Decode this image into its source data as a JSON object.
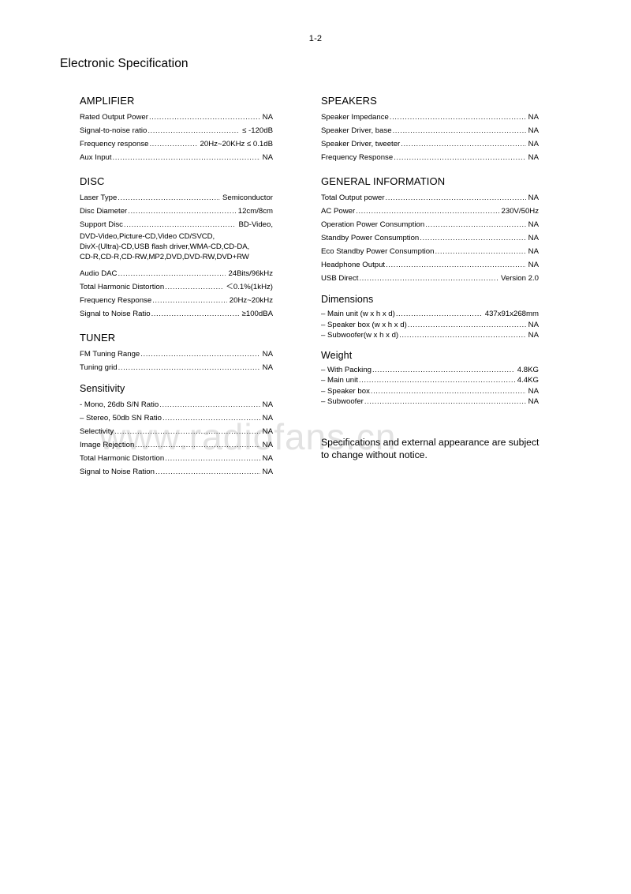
{
  "header": {
    "page_number": "1-2",
    "title": "Electronic Specification"
  },
  "watermark": "www.radiofans.cn",
  "left_column": {
    "amplifier": {
      "heading": "AMPLIFIER",
      "rows": [
        {
          "label": "Rated Output Power",
          "value": "NA"
        },
        {
          "label": "Signal-to-noise ratio",
          "value": "≤ -120dB"
        },
        {
          "label": "Frequency response",
          "value": "20Hz~20KHz  ≤ 0.1dB"
        },
        {
          "label": "Aux Input",
          "value": "NA"
        }
      ]
    },
    "disc": {
      "heading": "DISC",
      "rows": [
        {
          "label": "Laser Type",
          "value": "Semiconductor"
        },
        {
          "label": "Disc Diameter",
          "value": "12cm/8cm"
        },
        {
          "label": "Support Disc",
          "value": "BD-Video,"
        }
      ],
      "support_disc_continuation": [
        "DVD-Video,Picture-CD,Video CD/SVCD,",
        "DivX-(Ultra)-CD,USB flash driver,WMA-CD,CD-DA,",
        "CD-R,CD-R,CD-RW,MP2,DVD,DVD-RW,DVD+RW"
      ],
      "rows2": [
        {
          "label": "Audio DAC",
          "value": "24Bits/96kHz"
        },
        {
          "label": "Total Harmonic Distortion",
          "value": "＜0.1%(1kHz)"
        },
        {
          "label": "Frequency Response",
          "value": "20Hz~20kHz"
        },
        {
          "label": "Signal to Noise Ratio",
          "value": "≥100dBA"
        }
      ]
    },
    "tuner": {
      "heading": "TUNER",
      "rows": [
        {
          "label": "FM Tuning Range",
          "value": "NA"
        },
        {
          "label": "Tuning grid",
          "value": "NA"
        }
      ]
    },
    "sensitivity": {
      "heading": "Sensitivity",
      "rows": [
        {
          "label": "- Mono, 26db S/N Ratio",
          "value": "NA"
        },
        {
          "label": "– Stereo, 50db SN Ratio",
          "value": "NA"
        },
        {
          "label": "Selectivity",
          "value": "NA"
        },
        {
          "label": "Image Rejection",
          "value": "NA"
        },
        {
          "label": "Total Harmonic Distortion",
          "value": "NA"
        },
        {
          "label": "Signal to Noise Ration",
          "value": "NA"
        }
      ]
    }
  },
  "right_column": {
    "speakers": {
      "heading": "SPEAKERS",
      "rows": [
        {
          "label": "Speaker Impedance",
          "value": "NA"
        },
        {
          "label": "Speaker Driver, base",
          "value": "NA"
        },
        {
          "label": "Speaker Driver, tweeter",
          "value": "NA"
        },
        {
          "label": "Frequency Response",
          "value": "NA"
        }
      ]
    },
    "general_information": {
      "heading": "GENERAL INFORMATION",
      "rows": [
        {
          "label": "Total Output power",
          "value": "NA"
        },
        {
          "label": "AC Power",
          "value": "230V/50Hz"
        },
        {
          "label": "Operation Power Consumption",
          "value": "NA"
        },
        {
          "label": "Standby Power Consumption",
          "value": "NA"
        },
        {
          "label": "Eco Standby Power Consumption",
          "value": "NA"
        },
        {
          "label": "Headphone Output",
          "value": "NA"
        },
        {
          "label": "USB Direct",
          "value": "Version 2.0"
        }
      ]
    },
    "dimensions": {
      "heading": "Dimensions",
      "rows": [
        {
          "label": "– Main unit (w x h x d)",
          "value": "437x91x268mm"
        },
        {
          "label": "– Speaker box (w x h x d)",
          "value": "NA"
        },
        {
          "label": "– Subwoofer(w x h x d)",
          "value": "NA"
        }
      ]
    },
    "weight": {
      "heading": "Weight",
      "rows": [
        {
          "label": "– With Packing",
          "value": "4.8KG"
        },
        {
          "label": "– Main unit",
          "value": "4.4KG"
        },
        {
          "label": "– Speaker box",
          "value": "NA"
        },
        {
          "label": "– Subwoofer",
          "value": "NA"
        }
      ]
    },
    "note": "Specifications and external appearance are subject to change without notice."
  }
}
